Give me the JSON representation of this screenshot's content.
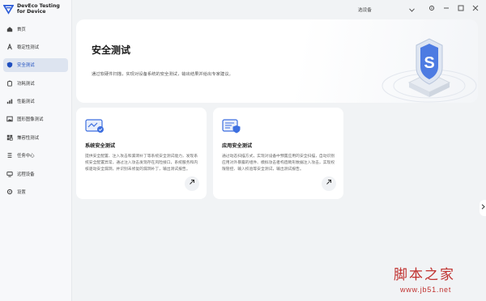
{
  "app": {
    "name_line1": "DevEco Testing",
    "name_line2": "for Device"
  },
  "sidebar": {
    "items": [
      {
        "label": "首页",
        "icon": "home-icon"
      },
      {
        "label": "稳定性测试",
        "icon": "stability-icon"
      },
      {
        "label": "安全测试",
        "icon": "shield-icon",
        "active": true
      },
      {
        "label": "功耗测试",
        "icon": "power-icon"
      },
      {
        "label": "性能测试",
        "icon": "performance-icon"
      },
      {
        "label": "图形图像测试",
        "icon": "image-icon"
      },
      {
        "label": "兼容性测试",
        "icon": "compat-icon"
      },
      {
        "label": "任务中心",
        "icon": "task-icon"
      },
      {
        "label": "远程设备",
        "icon": "remote-device-icon"
      },
      {
        "label": "设置",
        "icon": "gear-icon"
      }
    ]
  },
  "titlebar": {
    "device_select": "选设备",
    "window_controls": [
      "gear-icon",
      "minimize-icon",
      "maximize-icon",
      "close-icon"
    ]
  },
  "hero": {
    "title": "安全测试",
    "description": "通过软硬件扫描，实现对设备系统的安全测试，输出结果并给出专家建议。"
  },
  "cards": [
    {
      "title": "系统安全测试",
      "description": "提供安全配置、注入攻击和漏洞补丁等系统安全测试能力，发现系统安全配置异常，通过注入攻击发现存在风险接口，系统服务和内核驱动安全漏洞，并识别未修复的漏洞补丁，输出测试报告。"
    },
    {
      "title": "应用安全测试",
      "description": "通过动态扫描方式，实现对设备中预置应用的安全扫描，自动识别应用对外暴露的组件、模拟攻击者构造畸形数据注入攻击，实现权限管控、输入校验等安全测试，输出测试报告。"
    }
  ],
  "watermark": {
    "title": "脚本之家",
    "url": "www.jb51.net"
  },
  "colors": {
    "accent": "#1f4fbf",
    "sidebar_active_bg": "#dde4f0",
    "background": "#f1f3f5",
    "watermark": "#c0312f"
  }
}
